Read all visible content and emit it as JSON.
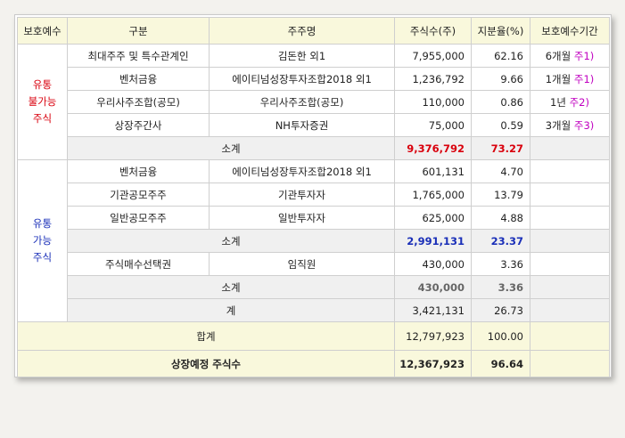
{
  "headers": {
    "lock_class": "보호예수",
    "category": "구분",
    "holder": "주주명",
    "shares": "주식수(주)",
    "ratio": "지분율(%)",
    "lock_period": "보호예수기간"
  },
  "locked": {
    "label_lines": [
      "유통",
      "불가능",
      "주식"
    ],
    "rows": [
      {
        "category": "최대주주 및 특수관계인",
        "holder": "김돈한 외1",
        "shares": "7,955,000",
        "ratio": "62.16",
        "period": "6개월",
        "note": "주1)"
      },
      {
        "category": "벤처금융",
        "holder": "에이티넘성장투자조합2018 외1",
        "shares": "1,236,792",
        "ratio": "9.66",
        "period": "1개월",
        "note": "주1)"
      },
      {
        "category": "우리사주조합(공모)",
        "holder": "우리사주조합(공모)",
        "shares": "110,000",
        "ratio": "0.86",
        "period": "1년",
        "note": "주2)"
      },
      {
        "category": "상장주간사",
        "holder": "NH투자증권",
        "shares": "75,000",
        "ratio": "0.59",
        "period": "3개월",
        "note": "주3)"
      }
    ],
    "subtotal": {
      "label": "소계",
      "shares": "9,376,792",
      "ratio": "73.27"
    }
  },
  "tradable": {
    "label_lines": [
      "유통",
      "가능",
      "주식"
    ],
    "rows": [
      {
        "category": "벤처금융",
        "holder": "에이티넘성장투자조합2018 외1",
        "shares": "601,131",
        "ratio": "4.70"
      },
      {
        "category": "기관공모주주",
        "holder": "기관투자자",
        "shares": "1,765,000",
        "ratio": "13.79"
      },
      {
        "category": "일반공모주주",
        "holder": "일반투자자",
        "shares": "625,000",
        "ratio": "4.88"
      }
    ],
    "subtotal1": {
      "label": "소계",
      "shares": "2,991,131",
      "ratio": "23.37"
    },
    "option_row": {
      "category": "주식매수선택권",
      "holder": "임직원",
      "shares": "430,000",
      "ratio": "3.36"
    },
    "subtotal2": {
      "label": "소계",
      "shares": "430,000",
      "ratio": "3.36"
    },
    "sum": {
      "label": "계",
      "shares": "3,421,131",
      "ratio": "26.73"
    }
  },
  "total": {
    "label": "합계",
    "shares": "12,797,923",
    "ratio": "100.00"
  },
  "listing": {
    "label": "상장예정 주식수",
    "shares": "12,367,923",
    "ratio": "96.64"
  }
}
